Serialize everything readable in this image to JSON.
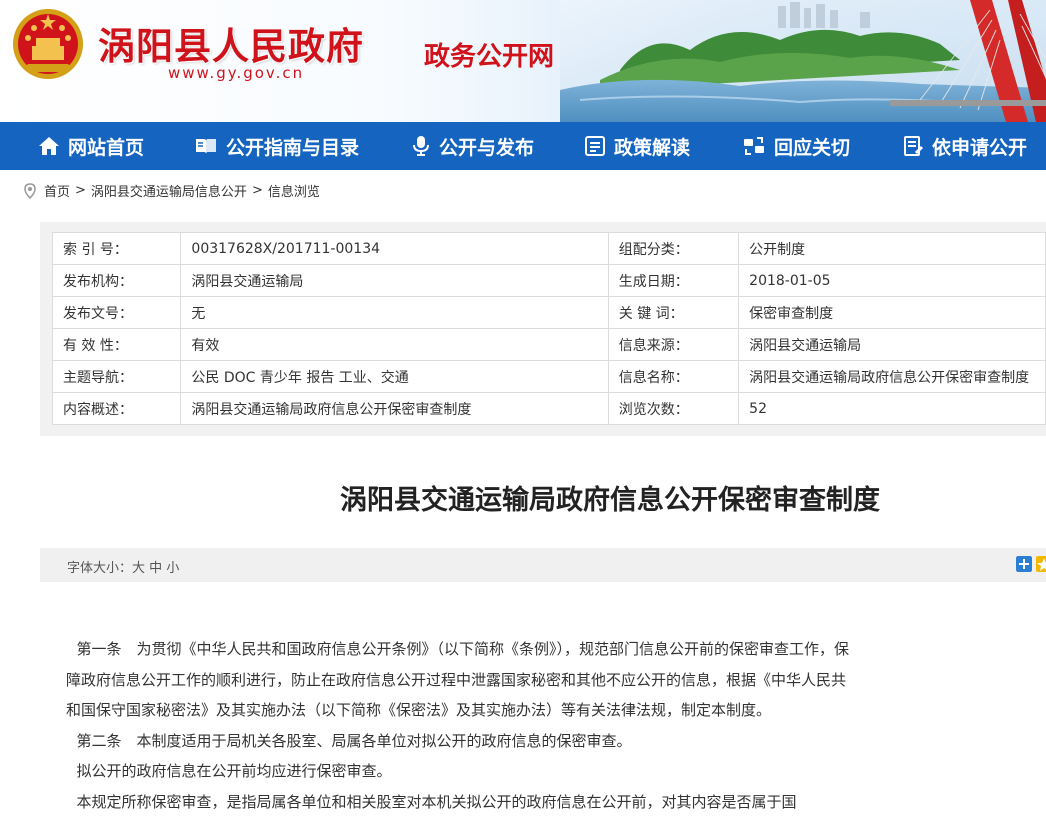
{
  "header": {
    "site_title": "涡阳县人民政府",
    "site_url": "www.gy.gov.cn",
    "portal_title": "政务公开网"
  },
  "nav": {
    "items": [
      {
        "label": "网站首页",
        "icon": "home-icon"
      },
      {
        "label": "公开指南与目录",
        "icon": "book-icon"
      },
      {
        "label": "公开与发布",
        "icon": "megaphone-icon"
      },
      {
        "label": "政策解读",
        "icon": "document-icon"
      },
      {
        "label": "回应关切",
        "icon": "exchange-icon"
      },
      {
        "label": "依申请公开",
        "icon": "form-icon"
      }
    ]
  },
  "breadcrumb": {
    "home": "首页",
    "level1": "涡阳县交通运输局信息公开",
    "level2": "信息浏览",
    "separator": ">"
  },
  "meta": {
    "rows": [
      {
        "k1": "索 引 号：",
        "v1": "00317628X/201711-00134",
        "k2": "组配分类：",
        "v2": "公开制度"
      },
      {
        "k1": "发布机构：",
        "v1": "涡阳县交通运输局",
        "k2": "生成日期：",
        "v2": "2018-01-05"
      },
      {
        "k1": "发布文号：",
        "v1": "无",
        "k2": "关 键 词：",
        "v2": "保密审查制度"
      },
      {
        "k1": "有 效 性：",
        "v1": "有效",
        "k2": "信息来源：",
        "v2": "涡阳县交通运输局"
      },
      {
        "k1": "主题导航：",
        "v1": "公民  DOC  青少年  报告  工业、交通",
        "k2": "信息名称：",
        "v2": "涡阳县交通运输局政府信息公开保密审查制度"
      },
      {
        "k1": "内容概述：",
        "v1": "涡阳县交通运输局政府信息公开保密审查制度",
        "k2": "浏览次数：",
        "v2": "52"
      }
    ]
  },
  "article": {
    "title": "涡阳县交通运输局政府信息公开保密审查制度",
    "font_size_label": "字体大小：",
    "font_large": "大",
    "font_medium": "中",
    "font_small": "小",
    "paragraphs": [
      "第一条　为贯彻《中华人民共和国政府信息公开条例》（以下简称《条例》），规范部门信息公开前的保密审查工作，保障政府信息公开工作的顺利进行，防止在政府信息公开过程中泄露国家秘密和其他不应公开的信息，根据《中华人民共和国保守国家秘密法》及其实施办法（以下简称《保密法》及其实施办法）等有关法律法规，制定本制度。",
      "第二条　本制度适用于局机关各股室、局属各单位对拟公开的政府信息的保密审查。",
      "拟公开的政府信息在公开前均应进行保密审查。",
      "本规定所称保密审查，是指局属各单位和相关股室对本机关拟公开的政府信息在公开前，对其内容是否属于国"
    ]
  },
  "colors": {
    "nav_bg": "#1565c0",
    "title_red": "#d0121b"
  }
}
